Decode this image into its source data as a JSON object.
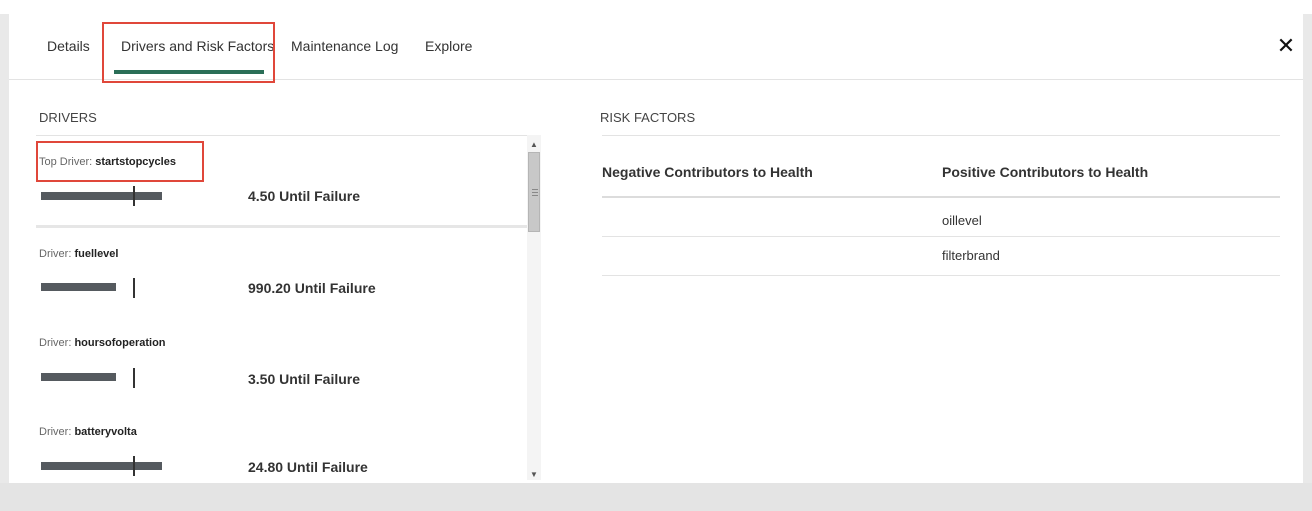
{
  "tabs": [
    {
      "label": "Details",
      "active": false
    },
    {
      "label": "Drivers and Risk Factors",
      "active": true
    },
    {
      "label": "Maintenance Log",
      "active": false
    },
    {
      "label": "Explore",
      "active": false
    }
  ],
  "close_label": "✕",
  "drivers": {
    "title": "DRIVERS",
    "items": [
      {
        "prefix": "Top Driver:",
        "name": "startstopcycles",
        "until": "4.50 Until Failure",
        "level": 0.77
      },
      {
        "prefix": "Driver:",
        "name": "fuellevel",
        "until": "990.20 Until Failure",
        "level": null
      },
      {
        "prefix": "Driver:",
        "name": "hoursofoperation",
        "until": "3.50 Until Failure",
        "level": null
      },
      {
        "prefix": "Driver:",
        "name": "batteryvolta",
        "until": "24.80 Until Failure",
        "level": 0.77
      }
    ]
  },
  "risk_factors": {
    "title": "RISK FACTORS",
    "negative_header": "Negative Contributors to Health",
    "positive_header": "Positive Contributors to Health",
    "rows": [
      {
        "negative": "",
        "positive": "oillevel"
      },
      {
        "negative": "",
        "positive": "filterbrand"
      }
    ]
  },
  "colors": {
    "accent": "#2a6e57",
    "highlight": "#e0473a",
    "bar": "#555a5f"
  }
}
